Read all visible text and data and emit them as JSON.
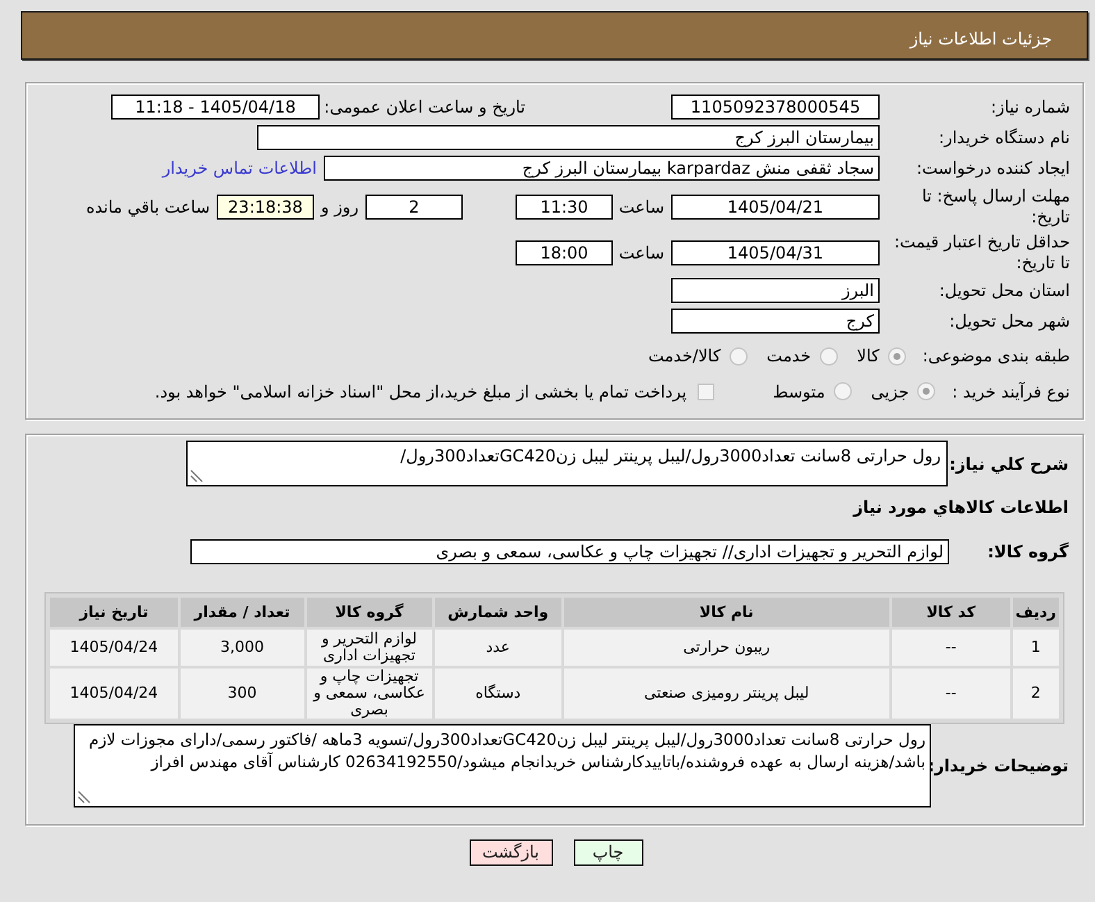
{
  "header": {
    "title": "جزئیات اطلاعات نیاز"
  },
  "details": {
    "need_number": {
      "label": "شماره نیاز:",
      "value": "1105092378000545"
    },
    "announcement": {
      "label": "تاریخ و ساعت اعلان عمومی:",
      "value": "1405/04/18 - 11:18"
    },
    "buyer_org": {
      "label": "نام دستگاه خریدار:",
      "value": "بیمارستان البرز کرج"
    },
    "requester": {
      "label": "ایجاد کننده درخواست:",
      "value": "سجاد ثقفی منش karpardaz بیمارستان البرز کرج",
      "contact_link": "اطلاعات تماس خریدار"
    },
    "reply_deadline": {
      "label": "مهلت ارسال پاسخ: تا تاریخ:",
      "date": "1405/04/21",
      "time_label": "ساعت",
      "time": "11:30",
      "days": "2",
      "days_label": "روز و",
      "remaining": "23:18:38",
      "remaining_label": "ساعت باقي مانده"
    },
    "price_validity": {
      "label": "حداقل تاریخ اعتبار قیمت: تا تاریخ:",
      "date": "1405/04/31",
      "time_label": "ساعت",
      "time": "18:00"
    },
    "province": {
      "label": "استان محل تحویل:",
      "value": "البرز"
    },
    "city": {
      "label": "شهر محل تحویل:",
      "value": "کرج"
    },
    "subject_class": {
      "label": "طبقه بندی موضوعی:",
      "disabled": true,
      "options": [
        {
          "label": "کالا",
          "selected": true
        },
        {
          "label": "خدمت",
          "selected": false
        },
        {
          "label": "کالا/خدمت",
          "selected": false
        }
      ]
    },
    "purchase_process": {
      "label": "نوع فرآیند خرید :",
      "disabled": true,
      "options": [
        {
          "label": "جزیی",
          "selected": true
        },
        {
          "label": "متوسط",
          "selected": false
        }
      ],
      "treasury": {
        "label": "پرداخت تمام یا بخشی از مبلغ خرید،از محل \"اسناد خزانه اسلامی\" خواهد بود.",
        "checked": false
      }
    }
  },
  "items": {
    "summary": {
      "label": "شرح کلي نیاز:",
      "value": "رول حرارتی 8سانت تعداد3000رول/لیبل پرینتر لیبل زنGC420تعداد300رول/"
    },
    "section_title": "اطلاعات کالاهاي مورد نیاز",
    "goods_group": {
      "label": "گروه کالا:",
      "value": "لوازم التحریر و تجهیزات اداری// تجهیزات چاپ و عکاسی، سمعی و بصری"
    },
    "table": {
      "columns": [
        "ردیف",
        "کد کالا",
        "نام کالا",
        "واحد شمارش",
        "گروه کالا",
        "تعداد / مقدار",
        "تاریخ نیاز"
      ],
      "rows": [
        [
          "1",
          "--",
          "ریبون حرارتی",
          "عدد",
          "لوازم التحریر و تجهیزات اداری",
          "3,000",
          "1405/04/24"
        ],
        [
          "2",
          "--",
          "لیبل پرینتر رومیزی صنعتی",
          "دستگاه",
          "تجهیزات چاپ و عکاسی، سمعی و بصری",
          "300",
          "1405/04/24"
        ]
      ]
    },
    "buyer_notes": {
      "label": "توضیحات خریدار:",
      "value": "رول حرارتی 8سانت تعداد3000رول/لیبل پرینتر لیبل زنGC420تعداد300رول/تسویه 3ماهه /فاکتور رسمی/دارای مجوزات لازم باشد/هزینه ارسال به عهده فروشنده/باتاییدکارشناس خریدانجام میشود/02634192550 کارشناس آقای مهندس افراز"
    }
  },
  "buttons": [
    {
      "label": "چاپ",
      "kind": "print"
    },
    {
      "label": "بازگشت",
      "kind": "back"
    }
  ]
}
